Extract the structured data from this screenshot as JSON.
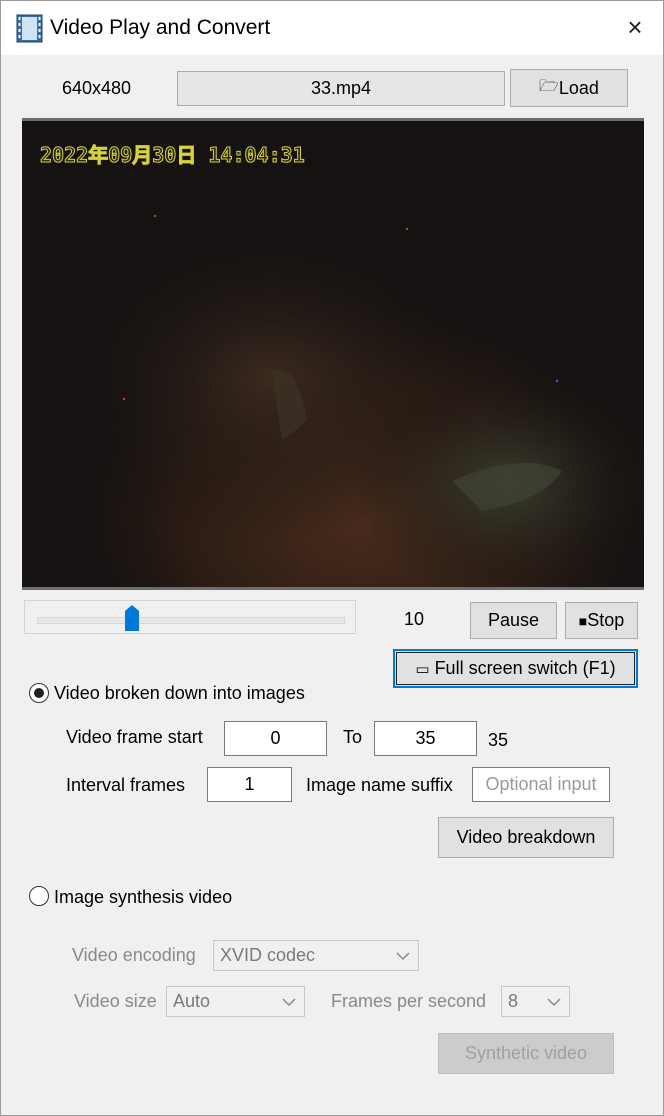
{
  "window": {
    "title": "Video Play and Convert",
    "icon": "film-strip-icon",
    "close_glyph": "×"
  },
  "top": {
    "resolution": "640x480",
    "filename": "33.mp4",
    "load_glyph": "🗁",
    "load_label": "Load"
  },
  "video": {
    "timestamp": "2022年09月30日 14:04:31"
  },
  "playback": {
    "frame_value": "10",
    "slider_fraction": 0.31,
    "pause_label": "Pause",
    "stop_glyph": "■",
    "stop_label": "Stop",
    "fullscreen_glyph": "▭",
    "fullscreen_label": "Full screen switch (F1)"
  },
  "breakdown": {
    "radio_label": "Video broken down into images",
    "selected": true,
    "frame_start_label": "Video frame start",
    "frame_start_value": "0",
    "to_label": "To",
    "frame_end_value": "35",
    "frame_total": "35",
    "interval_label": "Interval frames",
    "interval_value": "1",
    "suffix_label": "Image name suffix",
    "suffix_placeholder": "Optional input",
    "button_label": "Video breakdown"
  },
  "synthesis": {
    "radio_label": "Image synthesis video",
    "selected": false,
    "encoding_label": "Video encoding",
    "encoding_value": "XVID codec",
    "size_label": "Video size",
    "size_value": "Auto",
    "fps_label": "Frames per second",
    "fps_value": "8",
    "button_label": "Synthetic video"
  },
  "colors": {
    "accent": "#0078d7",
    "timestamp": "#d7d23a",
    "window_bg": "#f0f0f0"
  }
}
